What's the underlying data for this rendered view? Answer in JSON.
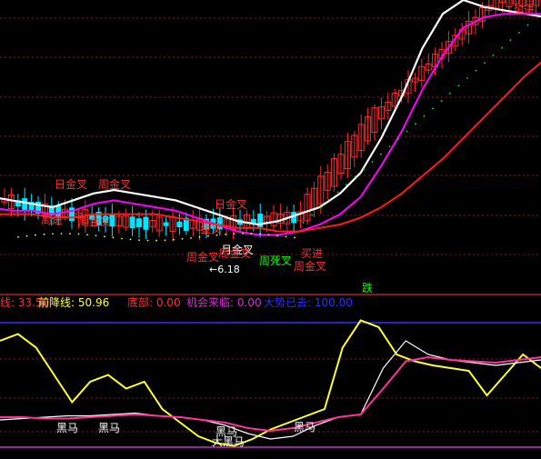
{
  "colors": {
    "background": "#000000",
    "grid": "#8b1a1a",
    "up_candle": "#ff2a2a",
    "down_candle": "#00e5ff",
    "ma_short": "#ffffff",
    "ma_mid": "#ff00ff",
    "ma_long": "#ff1a1a",
    "signal_yellow": "#ffff33",
    "signal_green": "#00ff00",
    "panel_divider": "#7f1d1d",
    "blue_line": "#3030ff",
    "magenta_line": "#cc33cc",
    "osc_yellow": "#ffff33",
    "osc_white": "#ffffff",
    "osc_pink": "#ff3399"
  },
  "main_annotations": [
    {
      "text": "日金叉",
      "color": "#ff3030"
    },
    {
      "text": "周金叉",
      "color": "#ff3030"
    },
    {
      "text": "周进",
      "color": "#ff3030"
    },
    {
      "text": "周金叉",
      "color": "#ff3030"
    },
    {
      "text": "日金叉",
      "color": "#ff3030"
    },
    {
      "text": "金叉",
      "color": "#ff3030"
    },
    {
      "text": "月金叉",
      "color": "#ffffff"
    },
    {
      "text": "周金叉",
      "color": "#ff3030"
    },
    {
      "text": "周死叉",
      "color": "#00ff00"
    },
    {
      "text": "周金叉",
      "color": "#ff3030"
    },
    {
      "text": "买进",
      "color": "#ff3030"
    },
    {
      "text": "周金叉",
      "color": "#ff3030"
    },
    {
      "text": "买进",
      "color": "#ff3030"
    },
    {
      "text": "跌",
      "color": "#00ff00"
    }
  ],
  "price_low_label": "←6.18",
  "indicator_header": [
    {
      "text": "线: 33.50",
      "color": "#ff3030"
    },
    {
      "text": "前降线: 50.96",
      "color": "#ffff33"
    },
    {
      "text": "底部: 0.00",
      "color": "#ff3030"
    },
    {
      "text": "机会来临: 0.00",
      "color": "#cc33cc"
    },
    {
      "text": "大势已去: 100.00",
      "color": "#3030ff"
    }
  ],
  "osc_labels": [
    "黑马",
    "黑马",
    "黑马",
    "大黑马",
    "黑马"
  ],
  "chart_data": [
    {
      "type": "candlestick",
      "title": "",
      "series": [
        {
          "values": [
            43,
            42,
            41,
            40,
            42,
            44,
            45,
            44,
            43,
            42,
            40,
            38,
            36,
            35,
            36,
            38,
            40,
            44,
            50,
            60,
            72,
            86,
            96,
            100,
            98,
            97,
            96,
            95
          ]
        },
        {
          "values": [
            40,
            39,
            39,
            38,
            39,
            41,
            42,
            41,
            40,
            39,
            37,
            35,
            33,
            32,
            32,
            33,
            35,
            38,
            43,
            52,
            62,
            74,
            84,
            92,
            95,
            96,
            96,
            96
          ]
        },
        {
          "values": [
            38,
            38,
            38,
            37,
            37,
            38,
            38,
            38,
            38,
            37,
            36,
            35,
            34,
            34,
            33,
            33,
            34,
            35,
            37,
            40,
            44,
            49,
            54,
            60,
            66,
            72,
            78,
            83
          ]
        }
      ],
      "ylim": [
        25,
        100
      ]
    },
    {
      "type": "line",
      "title": "",
      "series": [
        {
          "values": [
            80,
            85,
            75,
            55,
            35,
            50,
            55,
            45,
            50,
            30,
            20,
            10,
            5,
            3,
            8,
            15,
            20,
            25,
            30,
            75,
            95,
            90,
            70,
            65,
            62,
            60,
            58,
            40,
            55,
            70,
            60
          ]
        },
        {
          "values": [
            22,
            23,
            24,
            25,
            25,
            26,
            27,
            25,
            24,
            22,
            18,
            12,
            8,
            10,
            18,
            24,
            26,
            60,
            80,
            70,
            66,
            64,
            62,
            64,
            66
          ]
        },
        {
          "values": [
            24,
            24,
            23,
            23,
            24,
            25,
            26,
            25,
            24,
            22,
            20,
            16,
            14,
            16,
            20,
            24,
            26,
            45,
            65,
            68,
            66,
            65,
            64,
            66,
            68
          ]
        }
      ],
      "ylim": [
        0,
        100
      ]
    }
  ]
}
